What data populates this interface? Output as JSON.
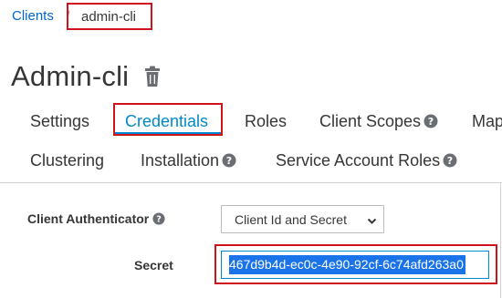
{
  "breadcrumb": {
    "parent": "Clients",
    "current": "admin-cli"
  },
  "page": {
    "title": "Admin-cli"
  },
  "tabs": {
    "settings": "Settings",
    "credentials": "Credentials",
    "roles": "Roles",
    "client_scopes": "Client Scopes",
    "mappers": "Map",
    "clustering": "Clustering",
    "installation": "Installation",
    "service_account_roles": "Service Account Roles"
  },
  "form": {
    "authenticator_label": "Client Authenticator",
    "authenticator_value": "Client Id and Secret",
    "secret_label": "Secret",
    "secret_value": "467d9b4d-ec0c-4e90-92cf-6c74afd263a0"
  },
  "colors": {
    "link": "#0066cc",
    "active_tab_underline": "#0088ce",
    "highlight_outline": "#d0121c",
    "selection": "#1a73e8"
  }
}
